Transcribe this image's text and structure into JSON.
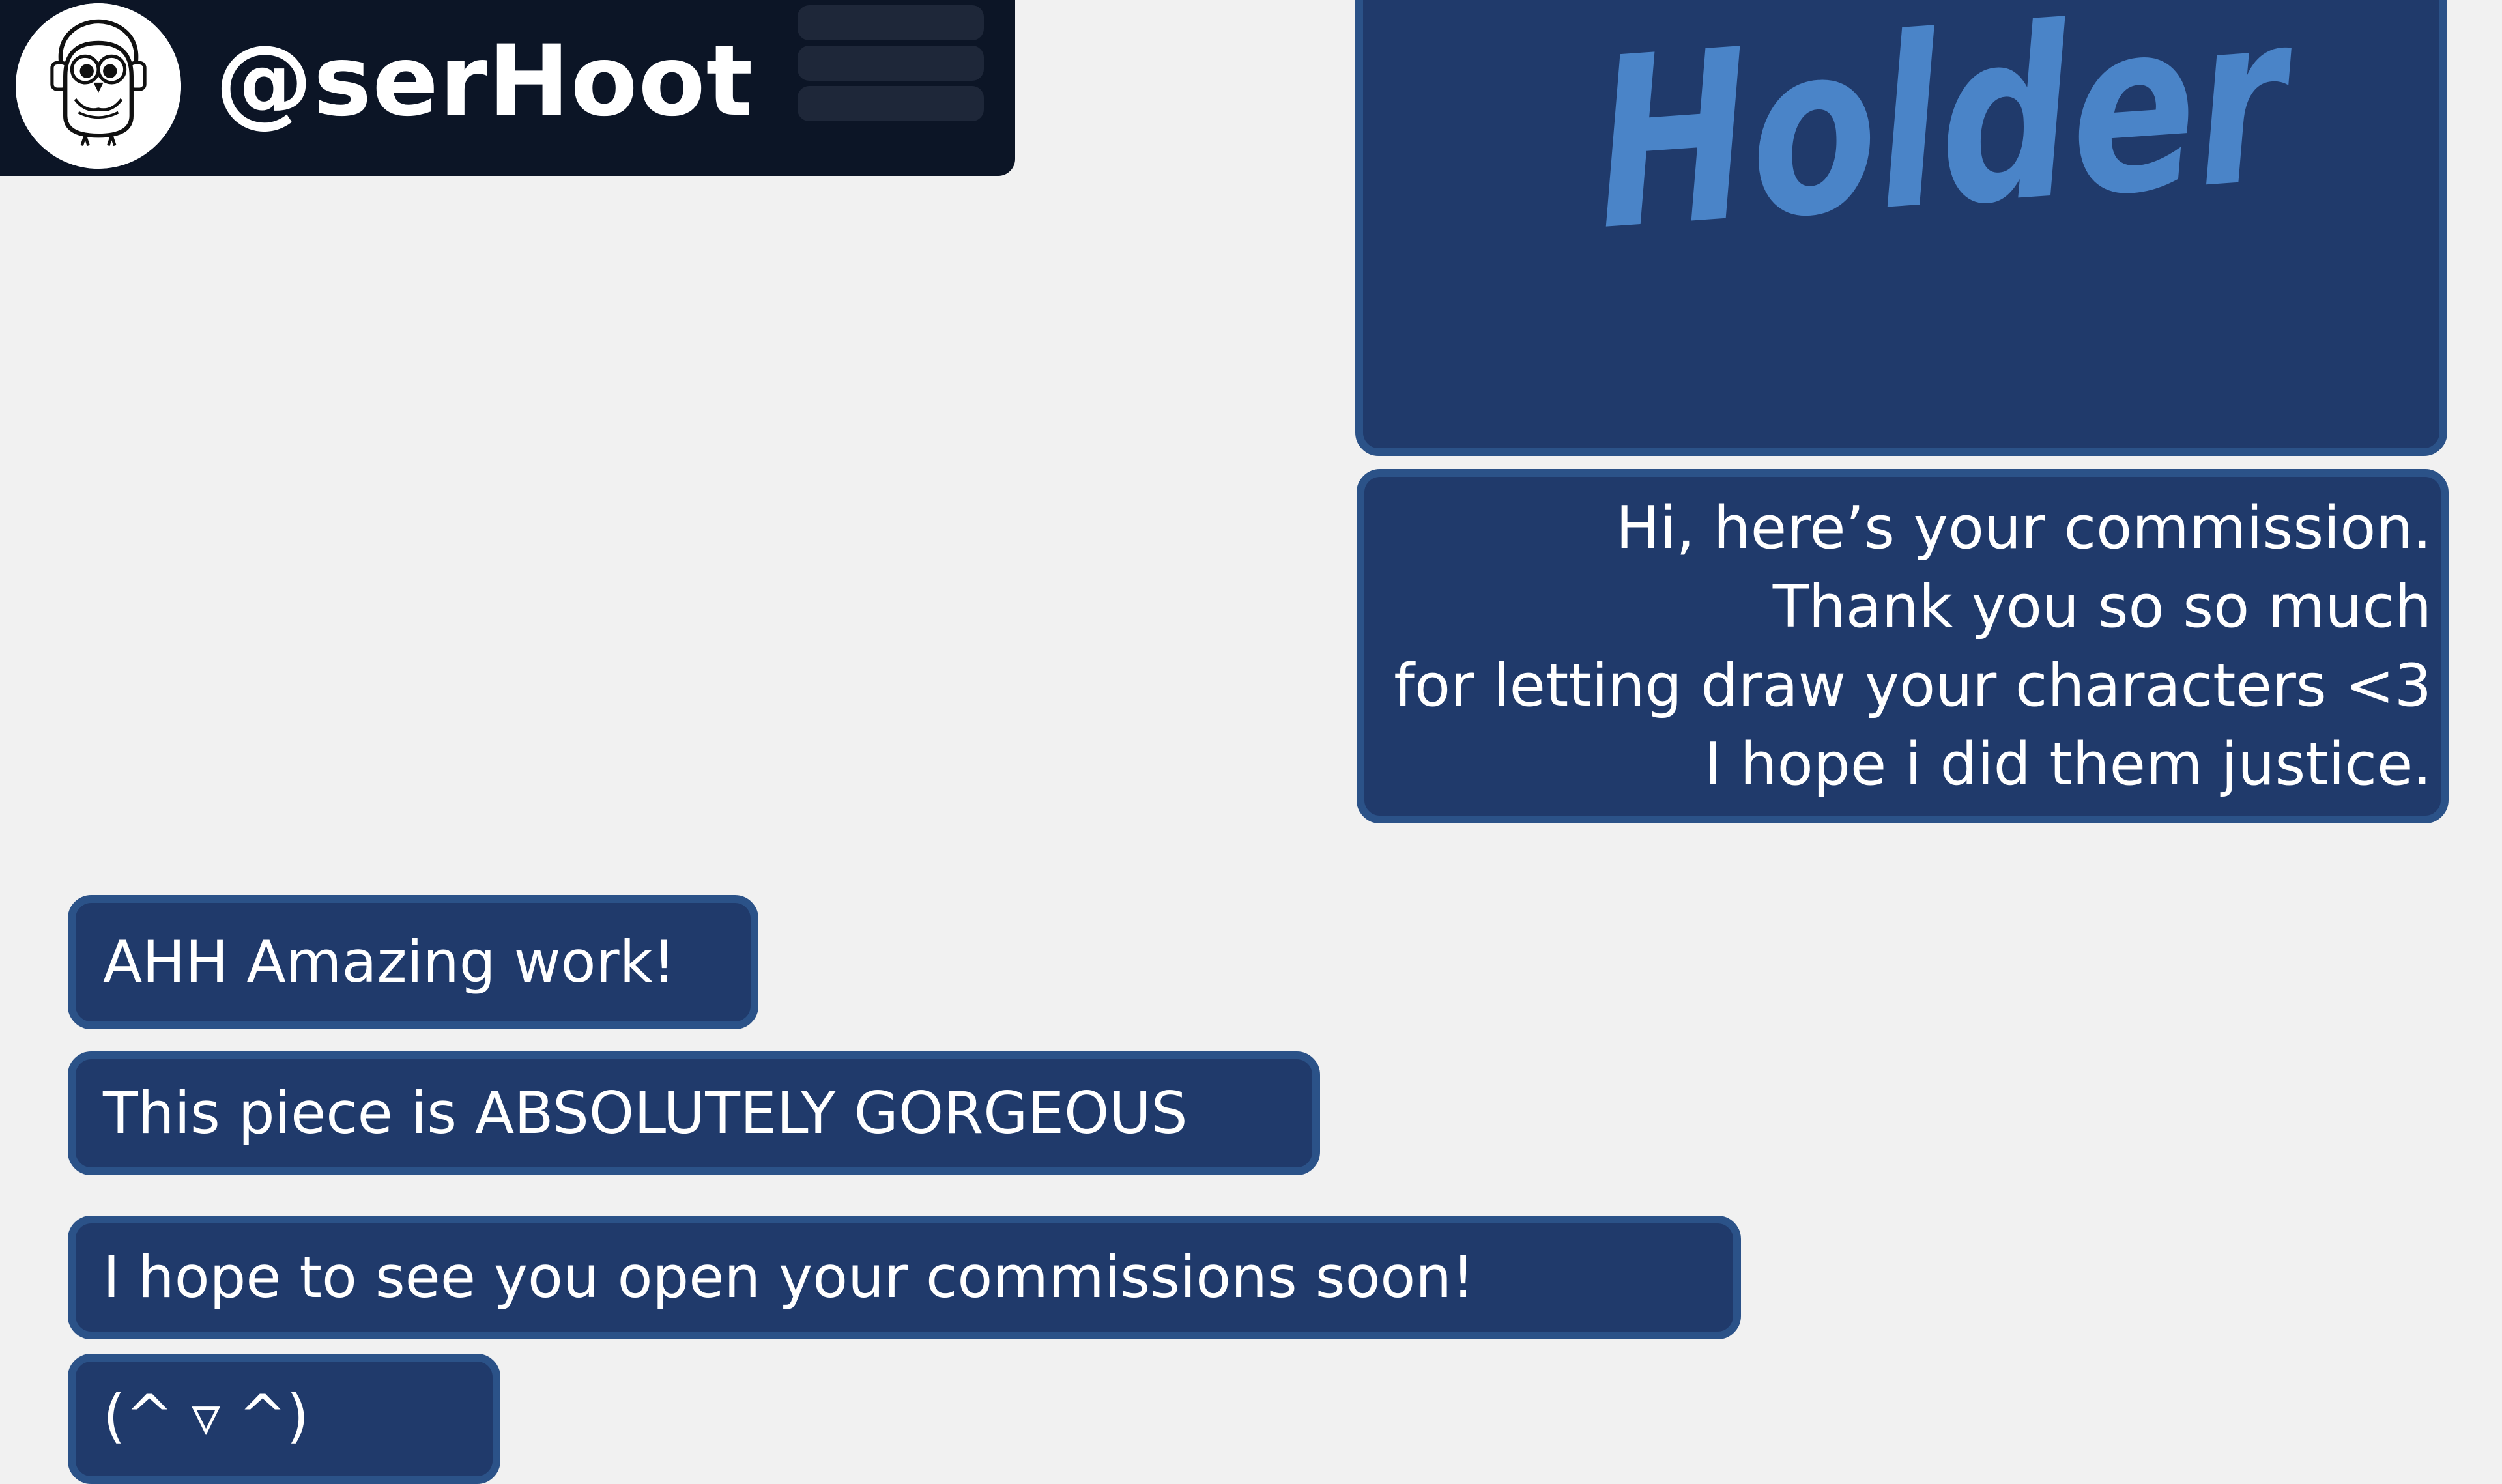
{
  "header": {
    "username": "@serHoot",
    "background_color": "#0c1526",
    "avatar_icon": "owl-avatar-icon",
    "menu_icon": "hamburger-menu-icon"
  },
  "conversation": {
    "sent": {
      "image": {
        "visible_text": "Holder",
        "text_color": "#4a84c8"
      },
      "message_lines": [
        "Hi, here’s your commission.",
        "Thank you so so much",
        "for letting draw your characters <3",
        "I hope i did them justice."
      ]
    },
    "received": [
      "AHH Amazing work!",
      "This piece is ABSOLUTELY GORGEOUS",
      "I hope to see you open your commissions soon!",
      "(^ ▿ ^)"
    ]
  },
  "colors": {
    "page_background": "#f1f1f1",
    "bubble_fill": "#203a6b",
    "bubble_border": "#2b5288",
    "text": "#ffffff"
  }
}
